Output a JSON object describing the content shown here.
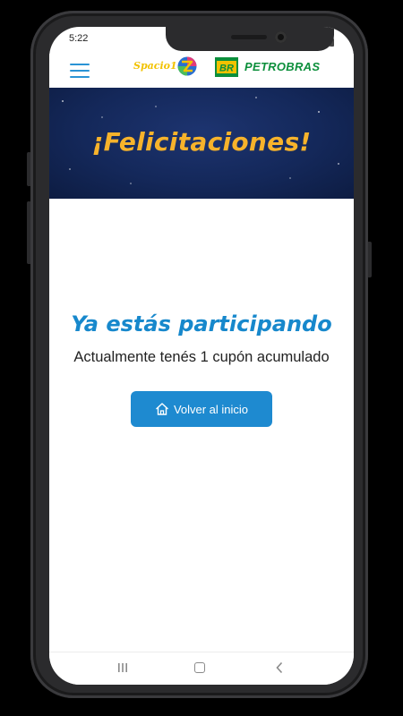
{
  "status_bar": {
    "time": "5:22"
  },
  "header": {
    "menu_icon": "hamburger-menu-icon",
    "spacio_logo_text": "Spacio1",
    "petrobras_badge_text": "BR",
    "petrobras_logo_text": "PETROBRAS"
  },
  "banner": {
    "title": "¡Felicitaciones!"
  },
  "main": {
    "headline": "Ya estás participando",
    "subline": "Actualmente tenés 1 cupón acumulado",
    "cta_label": "Volver al inicio",
    "cta_icon": "home-icon"
  },
  "colors": {
    "accent": "#1e8ad0",
    "headline": "#1788cc",
    "banner_title": "#f7b32b",
    "banner_bg": "#14285a",
    "petrobras_green": "#0c8f3b",
    "petrobras_yellow": "#f2c200"
  },
  "nav_bar": {
    "recent_icon": "recent-apps-icon",
    "home_icon": "home-square-icon",
    "back_icon": "back-chevron-icon"
  }
}
